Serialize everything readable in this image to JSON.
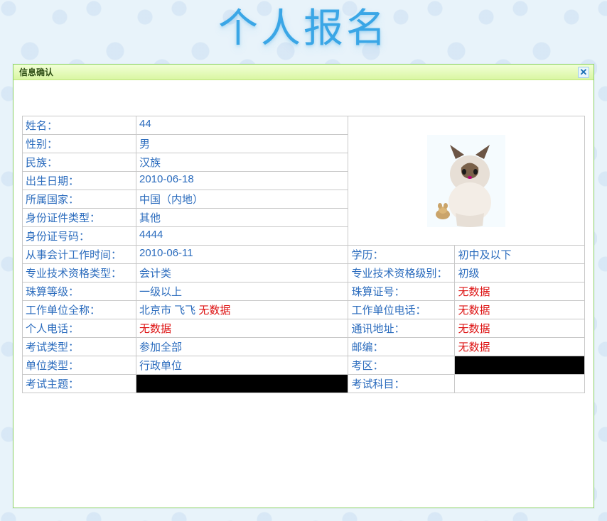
{
  "page_title": "个人报名",
  "panel": {
    "title": "信息确认"
  },
  "fields": {
    "name_label": "姓名：",
    "name_value": "44",
    "gender_label": "性别：",
    "gender_value": "男",
    "ethnic_label": "民族：",
    "ethnic_value": "汉族",
    "birth_label": "出生日期：",
    "birth_value": "2010-06-18",
    "country_label": "所属国家：",
    "country_value": "中国（内地）",
    "idtype_label": "身份证件类型：",
    "idtype_value": "其他",
    "idnum_label": "身份证号码：",
    "idnum_value": "4444",
    "worktime_label": "从事会计工作时间：",
    "worktime_value": "2010-06-11",
    "edu_label": "学历：",
    "edu_value": "初中及以下",
    "qualtype_label": "专业技术资格类型：",
    "qualtype_value": "会计类",
    "quallevel_label": "专业技术资格级别：",
    "quallevel_value": "初级",
    "abacus_label": "珠算等级：",
    "abacus_value": "一级以上",
    "abacuscert_label": "珠算证号：",
    "abacuscert_value": "无数据",
    "unit_label": "工作单位全称：",
    "unit_prefix": "北京市 飞飞",
    "unit_nodata": "无数据",
    "unittel_label": "工作单位电话：",
    "unittel_value": "无数据",
    "personaltel_label": "个人电话：",
    "personaltel_value": "无数据",
    "addr_label": "通讯地址：",
    "addr_value": "无数据",
    "examtype_label": "考试类型：",
    "examtype_value": "参加全部",
    "post_label": "邮编：",
    "post_value": "无数据",
    "unittype_label": "单位类型：",
    "unittype_value": "行政单位",
    "area_label": "考区：",
    "topic_label": "考试主题：",
    "subject_label": "考试科目："
  },
  "photo_alt": "上传的照片（小猫图片）"
}
